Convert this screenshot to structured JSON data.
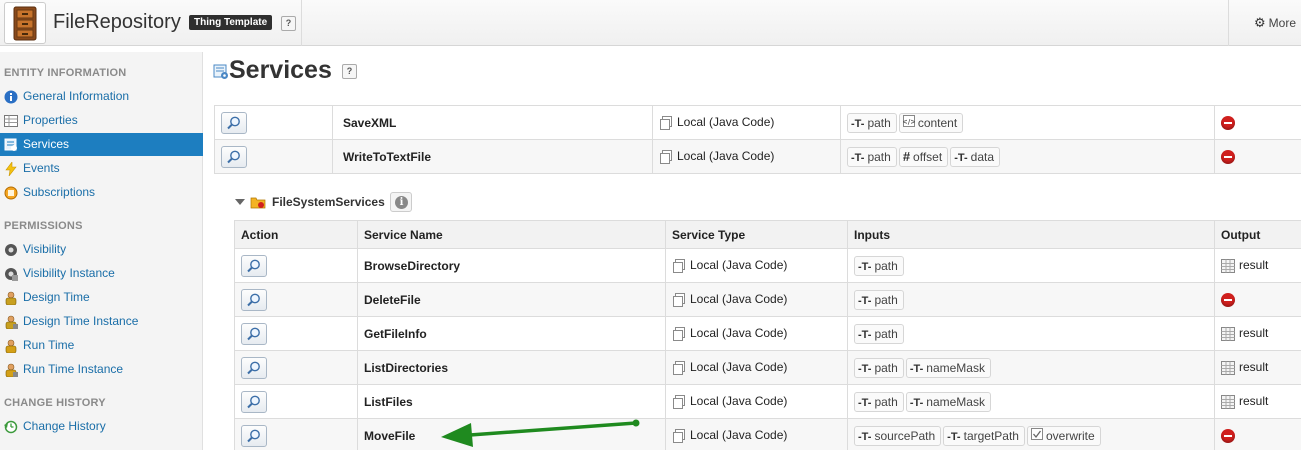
{
  "header": {
    "title": "FileRepository",
    "badge": "Thing Template",
    "help": "?",
    "more": "More"
  },
  "sidebar": {
    "sections": [
      {
        "heading": "ENTITY INFORMATION",
        "items": [
          {
            "label": "General Information",
            "icon": "info-icon"
          },
          {
            "label": "Properties",
            "icon": "properties-icon"
          },
          {
            "label": "Services",
            "icon": "services-icon",
            "active": true
          },
          {
            "label": "Events",
            "icon": "lightning-icon"
          },
          {
            "label": "Subscriptions",
            "icon": "subscriptions-icon"
          }
        ]
      },
      {
        "heading": "PERMISSIONS",
        "items": [
          {
            "label": "Visibility",
            "icon": "visibility-icon"
          },
          {
            "label": "Visibility Instance",
            "icon": "visibility-instance-icon"
          },
          {
            "label": "Design Time",
            "icon": "design-time-icon"
          },
          {
            "label": "Design Time Instance",
            "icon": "design-time-instance-icon"
          },
          {
            "label": "Run Time",
            "icon": "run-time-icon"
          },
          {
            "label": "Run Time Instance",
            "icon": "run-time-instance-icon"
          }
        ]
      },
      {
        "heading": "CHANGE HISTORY",
        "items": [
          {
            "label": "Change History",
            "icon": "history-icon"
          }
        ]
      }
    ]
  },
  "main": {
    "title": "Services",
    "help": "?",
    "top_rows": [
      {
        "name": "SaveXML",
        "type": "Local (Java Code)",
        "inputs": [
          {
            "icon": "string",
            "name": "path"
          },
          {
            "icon": "xml",
            "name": "content"
          }
        ],
        "output": {
          "kind": "none"
        }
      },
      {
        "name": "WriteToTextFile",
        "type": "Local (Java Code)",
        "inputs": [
          {
            "icon": "string",
            "name": "path"
          },
          {
            "icon": "number",
            "name": "offset"
          },
          {
            "icon": "string",
            "name": "data"
          }
        ],
        "output": {
          "kind": "none"
        }
      }
    ],
    "group": {
      "label": "FileSystemServices",
      "columns": {
        "action": "Action",
        "name": "Service Name",
        "type": "Service Type",
        "inputs": "Inputs",
        "output": "Output"
      },
      "rows": [
        {
          "name": "BrowseDirectory",
          "type": "Local (Java Code)",
          "inputs": [
            {
              "icon": "string",
              "name": "path"
            }
          ],
          "output": {
            "kind": "result",
            "label": "result"
          }
        },
        {
          "name": "DeleteFile",
          "type": "Local (Java Code)",
          "inputs": [
            {
              "icon": "string",
              "name": "path"
            }
          ],
          "output": {
            "kind": "none"
          }
        },
        {
          "name": "GetFileInfo",
          "type": "Local (Java Code)",
          "inputs": [
            {
              "icon": "string",
              "name": "path"
            }
          ],
          "output": {
            "kind": "result",
            "label": "result"
          }
        },
        {
          "name": "ListDirectories",
          "type": "Local (Java Code)",
          "inputs": [
            {
              "icon": "string",
              "name": "path"
            },
            {
              "icon": "string",
              "name": "nameMask"
            }
          ],
          "output": {
            "kind": "result",
            "label": "result"
          }
        },
        {
          "name": "ListFiles",
          "type": "Local (Java Code)",
          "inputs": [
            {
              "icon": "string",
              "name": "path"
            },
            {
              "icon": "string",
              "name": "nameMask"
            }
          ],
          "output": {
            "kind": "result",
            "label": "result"
          }
        },
        {
          "name": "MoveFile",
          "type": "Local (Java Code)",
          "inputs": [
            {
              "icon": "string",
              "name": "sourcePath"
            },
            {
              "icon": "string",
              "name": "targetPath"
            },
            {
              "icon": "boolean",
              "name": "overwrite"
            }
          ],
          "output": {
            "kind": "none"
          }
        }
      ]
    },
    "annotation_color": "#1f8a1f"
  },
  "colors": {
    "link": "#1a6ea8",
    "active_bg": "#1d7ec0",
    "remove": "#d0201e"
  }
}
